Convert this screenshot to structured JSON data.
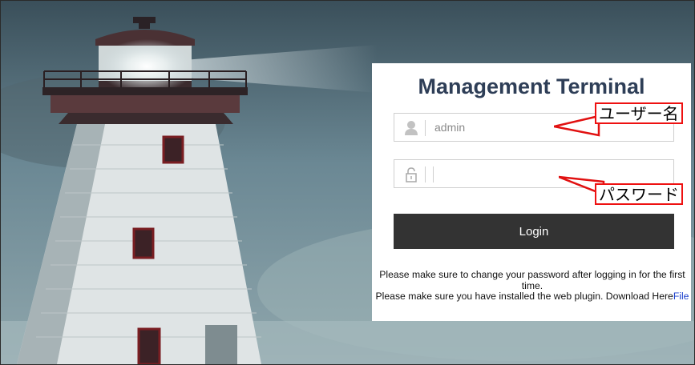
{
  "login": {
    "title": "Management Terminal",
    "username": {
      "value": "admin",
      "icon": "user-icon"
    },
    "password": {
      "value": "",
      "icon": "lock-icon"
    },
    "button_label": "Login",
    "note_line1": "Please make sure to change your password after logging in for the first time.",
    "note_line2_prefix": "Please make sure you have installed the web plugin. Download Here",
    "note_line2_link": "File"
  },
  "annotations": {
    "username_label": "ユーザー名",
    "password_label": "パスワード",
    "color": "#e11111"
  },
  "colors": {
    "title": "#2e3e57",
    "button": "#333333"
  }
}
